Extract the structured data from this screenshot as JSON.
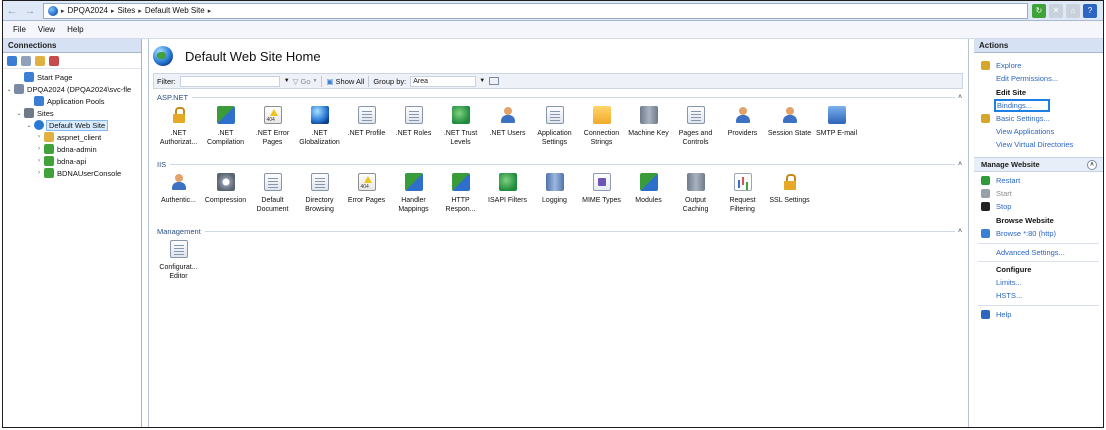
{
  "address": {
    "crumbs": [
      "DPQA2024",
      "Sites",
      "Default Web Site"
    ]
  },
  "menu": [
    "File",
    "View",
    "Help"
  ],
  "connections": {
    "title": "Connections",
    "tree": [
      {
        "label": "Start Page",
        "indent": 1,
        "expander": ""
      },
      {
        "label": "DPQA2024 (DPQA2024\\svc-fle",
        "indent": 0,
        "expander": "⌄"
      },
      {
        "label": "Application Pools",
        "indent": 2,
        "expander": ""
      },
      {
        "label": "Sites",
        "indent": 1,
        "expander": "⌄"
      },
      {
        "label": "Default Web Site",
        "indent": 2,
        "expander": "⌄"
      },
      {
        "label": "aspnet_client",
        "indent": 3,
        "expander": "›"
      },
      {
        "label": "bdna-admin",
        "indent": 3,
        "expander": "›"
      },
      {
        "label": "bdna-api",
        "indent": 3,
        "expander": "›"
      },
      {
        "label": "BDNAUserConsole",
        "indent": 3,
        "expander": "›"
      }
    ]
  },
  "main": {
    "title": "Default Web Site Home",
    "filter_label": "Filter:",
    "go_label": "Go",
    "show_all_label": "Show All",
    "group_by_label": "Group by:",
    "group_by_value": "Area",
    "groups": [
      {
        "name": "ASP.NET",
        "features": [
          {
            "label": ".NET Authorizat...",
            "icon": "ic-lock"
          },
          {
            "label": ".NET Compilation",
            "icon": "ic-arrows"
          },
          {
            "label": ".NET Error Pages",
            "icon": "ic-warn"
          },
          {
            "label": ".NET Globalization",
            "icon": "ic-globe"
          },
          {
            "label": ".NET Profile",
            "icon": "ic-doc"
          },
          {
            "label": ".NET Roles",
            "icon": "ic-doc"
          },
          {
            "label": ".NET Trust Levels",
            "icon": "ic-green"
          },
          {
            "label": ".NET Users",
            "icon": "ic-user"
          },
          {
            "label": "Application Settings",
            "icon": "ic-doc"
          },
          {
            "label": "Connection Strings",
            "icon": "ic-folder"
          },
          {
            "label": "Machine Key",
            "icon": "ic-server"
          },
          {
            "label": "Pages and Controls",
            "icon": "ic-doc"
          },
          {
            "label": "Providers",
            "icon": "ic-user"
          },
          {
            "label": "Session State",
            "icon": "ic-user"
          },
          {
            "label": "SMTP E-mail",
            "icon": "ic-blue"
          }
        ]
      },
      {
        "name": "IIS",
        "features": [
          {
            "label": "Authentic...",
            "icon": "ic-user"
          },
          {
            "label": "Compression",
            "icon": "ic-gear"
          },
          {
            "label": "Default Document",
            "icon": "ic-doc"
          },
          {
            "label": "Directory Browsing",
            "icon": "ic-doc"
          },
          {
            "label": "Error Pages",
            "icon": "ic-warn"
          },
          {
            "label": "Handler Mappings",
            "icon": "ic-arrows"
          },
          {
            "label": "HTTP Respon...",
            "icon": "ic-arrows"
          },
          {
            "label": "ISAPI Filters",
            "icon": "ic-green"
          },
          {
            "label": "Logging",
            "icon": "ic-cyl"
          },
          {
            "label": "MIME Types",
            "icon": "ic-mime"
          },
          {
            "label": "Modules",
            "icon": "ic-arrows"
          },
          {
            "label": "Output Caching",
            "icon": "ic-server"
          },
          {
            "label": "Request Filtering",
            "icon": "ic-chart"
          },
          {
            "label": "SSL Settings",
            "icon": "ic-lock"
          }
        ]
      },
      {
        "name": "Management",
        "features": [
          {
            "label": "Configurat... Editor",
            "icon": "ic-doc"
          }
        ]
      }
    ]
  },
  "actions": {
    "title": "Actions",
    "top": [
      {
        "label": "Explore",
        "icon": true,
        "type": "link"
      },
      {
        "label": "Edit Permissions...",
        "icon": false,
        "type": "link"
      }
    ],
    "edit_site": {
      "title": "Edit Site",
      "items": [
        {
          "label": "Bindings...",
          "icon": false,
          "type": "boxed"
        },
        {
          "label": "Basic Settings...",
          "icon": true,
          "type": "link"
        },
        {
          "label": "View Applications",
          "icon": false,
          "type": "link"
        },
        {
          "label": "View Virtual Directories",
          "icon": false,
          "type": "link"
        }
      ]
    },
    "manage_website": {
      "title": "Manage Website",
      "items": [
        {
          "label": "Restart",
          "icon": true,
          "type": "link",
          "color": "#2f9a38"
        },
        {
          "label": "Start",
          "icon": true,
          "type": "disabled",
          "color": "#9aa0a8"
        },
        {
          "label": "Stop",
          "icon": true,
          "type": "link",
          "color": "#222222"
        }
      ],
      "browse_title": "Browse Website",
      "browse_items": [
        {
          "label": "Browse *:80 (http)",
          "icon": true,
          "type": "link",
          "color": "#3b7fd4"
        }
      ],
      "advanced": "Advanced Settings...",
      "configure_title": "Configure",
      "configure_items": [
        "Limits...",
        "HSTS..."
      ]
    },
    "help_label": "Help"
  }
}
